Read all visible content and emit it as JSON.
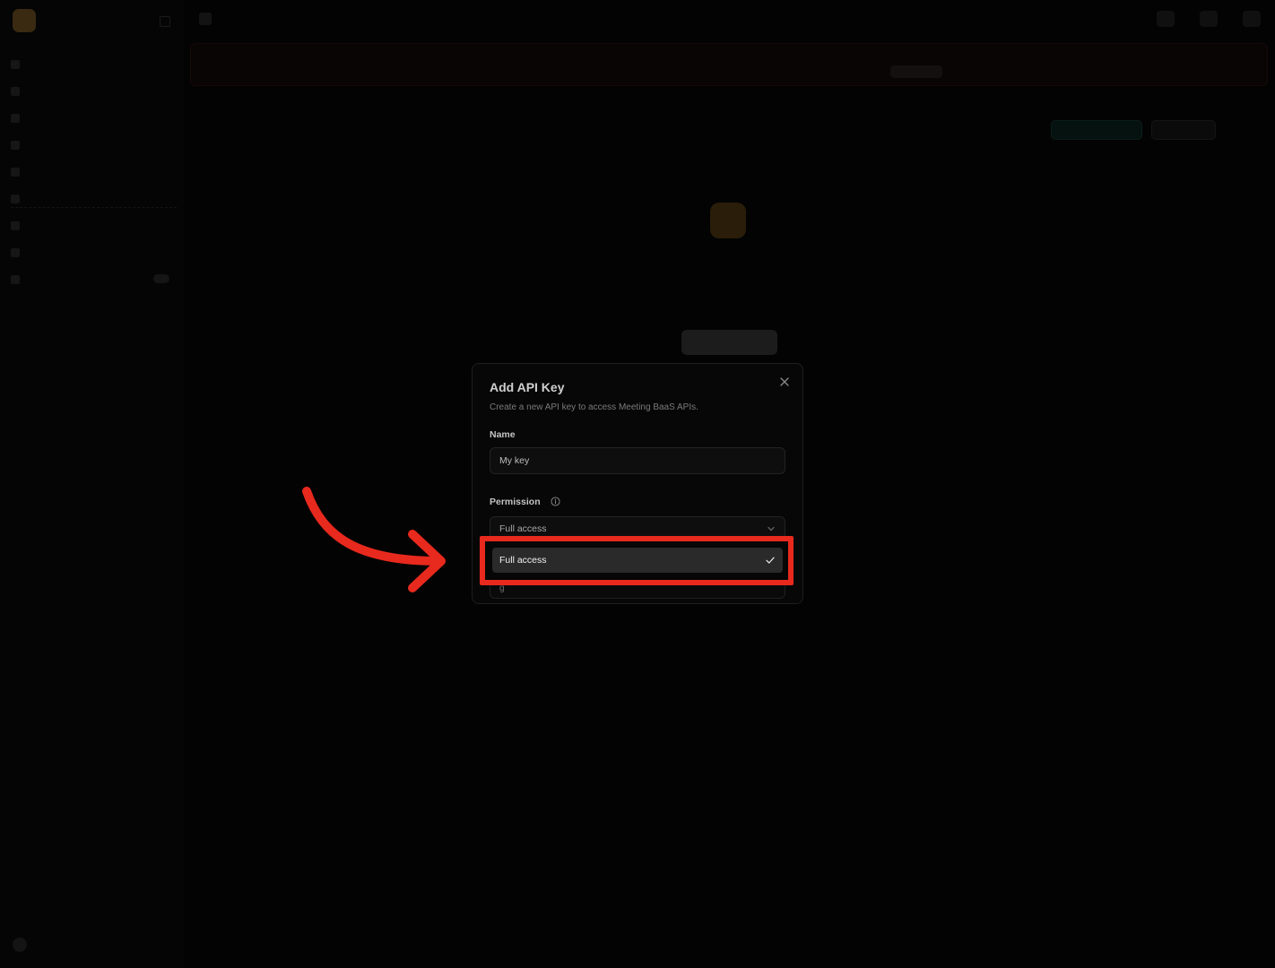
{
  "modal": {
    "title": "Add API Key",
    "description": "Create a new API key to access Meeting BaaS APIs.",
    "name_label": "Name",
    "name_value": "My key",
    "permission_label": "Permission",
    "permission_selected": "Full access",
    "dropdown_options": [
      {
        "label": "Full access",
        "selected": true
      }
    ]
  },
  "annotation": {
    "highlight_color": "#e8291d",
    "arrow_color": "#e8291d"
  },
  "icons": {
    "close": "close-icon",
    "info": "info-icon",
    "chevron": "chevron-down-icon",
    "check": "check-icon"
  }
}
